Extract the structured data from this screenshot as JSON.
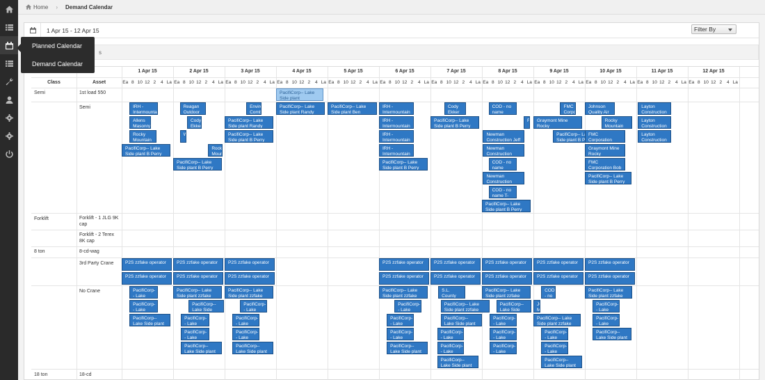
{
  "sidebar": {
    "icons": [
      "home-icon",
      "list-icon",
      "calendar-icon",
      "list-icon",
      "wrench-icon",
      "user-icon",
      "gear-icon",
      "gear-icon",
      "power-icon"
    ],
    "active_index": 2
  },
  "flyout": {
    "items": [
      "Planned Calendar",
      "Demand Calendar"
    ]
  },
  "breadcrumb": {
    "home": "Home",
    "current": "Demand Calendar"
  },
  "header": {
    "date_range": "1 Apr 15 - 12 Apr 15",
    "filter_label": "Filter By"
  },
  "tabs": {
    "partial_label": "s"
  },
  "grid": {
    "col_class": "Class",
    "col_asset": "Asset",
    "days": [
      "1 Apr 15",
      "2 Apr 15",
      "3 Apr 15",
      "4 Apr 15",
      "5 Apr 15",
      "6 Apr 15",
      "7 Apr 15",
      "8 Apr 15",
      "9 Apr 15",
      "10 Apr 15",
      "11 Apr 15",
      "12 Apr 15"
    ],
    "hours": [
      "Ea",
      "8",
      "10",
      "12",
      "2",
      "4",
      "La"
    ],
    "classes": [
      "Semi",
      "Forklift",
      "8 ton",
      "18 ton"
    ],
    "assets": [
      "1st load 550",
      "Semi",
      "Forklift - 1 JLG 9K cap",
      "Forklift - 2 Terex 8K cap",
      "8-cd-wag",
      "3rd Party Crane",
      "No Crane",
      "18-cd"
    ]
  },
  "events": [
    {
      "text": "PacifiCorp-- Lake Side plant",
      "day": 3,
      "start": 0.0,
      "width": 0.92,
      "row": 0,
      "sel": true
    },
    {
      "text": "PacifiCorp-- Lake Side plant Randy",
      "day": 3,
      "start": 0.0,
      "width": 0.94,
      "row": 1
    },
    {
      "text": "PacifiCorp-- Lake Side plant Ben",
      "day": 4,
      "start": 0.0,
      "width": 0.96,
      "row": 1
    },
    {
      "text": "IRH - Intermountain",
      "day": 0,
      "start": 0.15,
      "width": 0.55,
      "row": 1
    },
    {
      "text": "Allens Masonry",
      "day": 0,
      "start": 0.15,
      "width": 0.42,
      "row": 2
    },
    {
      "text": "Rocky Mountain",
      "day": 0,
      "start": 0.15,
      "width": 0.52,
      "row": 3
    },
    {
      "text": "PacifiCorp-- Lake Side plant B Perry",
      "day": 0,
      "start": 0.0,
      "width": 0.95,
      "row": 4
    },
    {
      "text": "Reagan Outdoor",
      "day": 1,
      "start": 0.13,
      "width": 0.5,
      "row": 1
    },
    {
      "text": "Cody Ekker",
      "day": 1,
      "start": 0.27,
      "width": 0.28,
      "row": 2
    },
    {
      "text": "W",
      "day": 1,
      "start": 0.13,
      "width": 0.08,
      "row": 3
    },
    {
      "text": "Rocky Moun",
      "day": 1,
      "start": 0.68,
      "width": 0.28,
      "row": 4
    },
    {
      "text": "PacifiCorp-- Lake Side plant B Perry",
      "day": 1,
      "start": 0.0,
      "width": 0.95,
      "row": 5
    },
    {
      "text": "Enviro Comb",
      "day": 2,
      "start": 0.42,
      "width": 0.3,
      "row": 1
    },
    {
      "text": "PacifiCorp-- Lake Side plant Randy",
      "day": 2,
      "start": 0.0,
      "width": 0.95,
      "row": 2
    },
    {
      "text": "PacifiCorp-- Lake Side plant B Perry",
      "day": 2,
      "start": 0.0,
      "width": 0.95,
      "row": 3
    },
    {
      "text": "IRH - Intermountain",
      "day": 5,
      "start": 0.0,
      "width": 0.68,
      "row": 1
    },
    {
      "text": "IRH - Intermountain",
      "day": 5,
      "start": 0.0,
      "width": 0.68,
      "row": 2
    },
    {
      "text": "IRH - Intermountain",
      "day": 5,
      "start": 0.0,
      "width": 0.68,
      "row": 3
    },
    {
      "text": "IRH - Intermountain",
      "day": 5,
      "start": 0.0,
      "width": 0.68,
      "row": 4
    },
    {
      "text": "PacifiCorp-- Lake Side plant B Perry",
      "day": 5,
      "start": 0.0,
      "width": 0.95,
      "row": 5
    },
    {
      "text": "Cody Ekker",
      "day": 6,
      "start": 0.27,
      "width": 0.42,
      "row": 1
    },
    {
      "text": "PacifiCorp-- Lake Side plant B Perry",
      "day": 6,
      "start": 0.0,
      "width": 0.95,
      "row": 2
    },
    {
      "text": "COD - no name",
      "day": 7,
      "start": 0.13,
      "width": 0.55,
      "row": 1
    },
    {
      "text": "F",
      "day": 7,
      "start": 0.81,
      "width": 0.08,
      "row": 2
    },
    {
      "text": "Newman Construction Jeff",
      "day": 7,
      "start": 0.02,
      "width": 0.8,
      "row": 3
    },
    {
      "text": "Newman Construction Josh",
      "day": 7,
      "start": 0.02,
      "width": 0.8,
      "row": 4
    },
    {
      "text": "COD - no name",
      "day": 7,
      "start": 0.13,
      "width": 0.55,
      "row": 5
    },
    {
      "text": "Newman Construction",
      "day": 7,
      "start": 0.02,
      "width": 0.8,
      "row": 6
    },
    {
      "text": "COD - no name T-",
      "day": 7,
      "start": 0.13,
      "width": 0.55,
      "row": 7
    },
    {
      "text": "PacifiCorp-- Lake Side plant B Perry",
      "day": 7,
      "start": 0.0,
      "width": 0.95,
      "row": 8
    },
    {
      "text": "FMC Corpo",
      "day": 8,
      "start": 0.52,
      "width": 0.3,
      "row": 1
    },
    {
      "text": "Graymont Mine Rocky",
      "day": 8,
      "start": 0.0,
      "width": 0.95,
      "row": 2
    },
    {
      "text": "PacifiCorp-- Lake Side plant B Perry",
      "day": 8,
      "start": 0.38,
      "width": 0.95,
      "row": 3
    },
    {
      "text": "Johnson Quality Air",
      "day": 9,
      "start": 0.0,
      "width": 0.58,
      "row": 1
    },
    {
      "text": "Rocky Mountain",
      "day": 9,
      "start": 0.32,
      "width": 0.6,
      "row": 2
    },
    {
      "text": "FMC Corporation Randy",
      "day": 9,
      "start": 0.0,
      "width": 0.78,
      "row": 3
    },
    {
      "text": "Graymont Mine Rocky",
      "day": 9,
      "start": 0.0,
      "width": 0.78,
      "row": 4
    },
    {
      "text": "FMC Corporation Bob S",
      "day": 9,
      "start": 0.0,
      "width": 0.78,
      "row": 5
    },
    {
      "text": "PacifiCorp-- Lake Side plant B Perry",
      "day": 9,
      "start": 0.0,
      "width": 0.9,
      "row": 6
    },
    {
      "text": "Layton Construction",
      "day": 10,
      "start": 0.03,
      "width": 0.65,
      "row": 1
    },
    {
      "text": "Layton Construction",
      "day": 10,
      "start": 0.03,
      "width": 0.65,
      "row": 2
    },
    {
      "text": "Layton Construction",
      "day": 10,
      "start": 0.03,
      "width": 0.65,
      "row": 3
    }
  ],
  "crane_events": [
    {
      "text": "P2S zzfake operator",
      "day": 0,
      "row": 0
    },
    {
      "text": "P2S zzfake operator",
      "day": 0,
      "row": 1
    },
    {
      "text": "P2S zzfake operator",
      "day": 1,
      "row": 0
    },
    {
      "text": "P2S zzfake operator",
      "day": 1,
      "row": 1
    },
    {
      "text": "P2S zzfake operator",
      "day": 2,
      "row": 0
    },
    {
      "text": "P2S zzfake operator",
      "day": 2,
      "row": 1
    },
    {
      "text": "P2S zzfake operator",
      "day": 5,
      "row": 0
    },
    {
      "text": "P2S zzfake operator",
      "day": 5,
      "row": 1
    },
    {
      "text": "P2S zzfake operator",
      "day": 6,
      "row": 0
    },
    {
      "text": "P2S zzfake operator",
      "day": 6,
      "row": 1
    },
    {
      "text": "P2S zzfake operator",
      "day": 7,
      "row": 0
    },
    {
      "text": "P2S zzfake operator",
      "day": 7,
      "row": 1
    },
    {
      "text": "P2S zzfake operator",
      "day": 8,
      "row": 0
    },
    {
      "text": "P2S zzfake operator",
      "day": 8,
      "row": 1
    },
    {
      "text": "P2S zzfake operator",
      "day": 9,
      "row": 0
    },
    {
      "text": "P2S zzfake operator",
      "day": 9,
      "row": 1
    }
  ],
  "nocrane_events": [
    {
      "text": "PacifiCorp-- Lake",
      "day": 0,
      "start": 0.15,
      "width": 0.55,
      "row": 0
    },
    {
      "text": "PacifiCorp-- Lake",
      "day": 0,
      "start": 0.15,
      "width": 0.55,
      "row": 1
    },
    {
      "text": "PacifiCorp-- Lake Side plant zzfake",
      "day": 0,
      "start": 0.15,
      "width": 0.8,
      "row": 2
    },
    {
      "text": "PacifiCorp-- Lake Side plant zzfake",
      "day": 1,
      "start": 0.0,
      "width": 0.95,
      "row": 0
    },
    {
      "text": "PacifiCorp-- Lake Side",
      "day": 1,
      "start": 0.3,
      "width": 0.68,
      "row": 1
    },
    {
      "text": "PacifiCorp-- Lake",
      "day": 1,
      "start": 0.15,
      "width": 0.55,
      "row": 2
    },
    {
      "text": "PacifiCorp-- Lake",
      "day": 1,
      "start": 0.15,
      "width": 0.55,
      "row": 3
    },
    {
      "text": "PacifiCorp-- Lake Side plant zzfake",
      "day": 1,
      "start": 0.15,
      "width": 0.8,
      "row": 4
    },
    {
      "text": "PacifiCorp-- Lake Side plant zzfake",
      "day": 2,
      "start": 0.0,
      "width": 0.95,
      "row": 0
    },
    {
      "text": "PacifiCorp-- Lake",
      "day": 2,
      "start": 0.3,
      "width": 0.52,
      "row": 1
    },
    {
      "text": "PacifiCorp-- Lake",
      "day": 2,
      "start": 0.15,
      "width": 0.52,
      "row": 2
    },
    {
      "text": "PacifiCorp-- Lake",
      "day": 2,
      "start": 0.15,
      "width": 0.52,
      "row": 3
    },
    {
      "text": "PacifiCorp-- Lake Side plant zzfake",
      "day": 2,
      "start": 0.15,
      "width": 0.8,
      "row": 4
    },
    {
      "text": "PacifiCorp-- Lake Side plant zzfake",
      "day": 5,
      "start": 0.0,
      "width": 0.95,
      "row": 0
    },
    {
      "text": "PacifiCorp-- Lake",
      "day": 5,
      "start": 0.3,
      "width": 0.52,
      "row": 1
    },
    {
      "text": "PacifiCorp-- Lake",
      "day": 5,
      "start": 0.15,
      "width": 0.52,
      "row": 2
    },
    {
      "text": "PacifiCorp-- Lake",
      "day": 5,
      "start": 0.15,
      "width": 0.52,
      "row": 3
    },
    {
      "text": "PacifiCorp-- Lake Side plant zzfake",
      "day": 5,
      "start": 0.15,
      "width": 0.8,
      "row": 4
    },
    {
      "text": "S.L. County",
      "day": 6,
      "start": 0.15,
      "width": 0.52,
      "row": 0
    },
    {
      "text": "PacifiCorp-- Lake Side plant zzfake",
      "day": 6,
      "start": 0.2,
      "width": 0.95,
      "row": 1
    },
    {
      "text": "PacifiCorp-- Lake Side plant",
      "day": 6,
      "start": 0.2,
      "width": 0.8,
      "row": 2
    },
    {
      "text": "PacifiCorp-- Lake",
      "day": 6,
      "start": 0.13,
      "width": 0.52,
      "row": 3
    },
    {
      "text": "PacifiCorp-- Lake",
      "day": 6,
      "start": 0.13,
      "width": 0.52,
      "row": 4
    },
    {
      "text": "PacifiCorp-- Lake Side plant zzfake",
      "day": 6,
      "start": 0.13,
      "width": 0.8,
      "row": 5
    },
    {
      "text": "PacifiCorp-- Lake Side plant zzfake",
      "day": 7,
      "start": 0.0,
      "width": 0.95,
      "row": 0
    },
    {
      "text": "PacifiCorp-- Lake Side plant zzfake",
      "day": 7,
      "start": 0.28,
      "width": 0.68,
      "row": 1
    },
    {
      "text": "PacifiCorp-- Lake",
      "day": 7,
      "start": 0.15,
      "width": 0.52,
      "row": 2
    },
    {
      "text": "PacifiCorp-- Lake",
      "day": 7,
      "start": 0.15,
      "width": 0.52,
      "row": 3
    },
    {
      "text": "PacifiCorp-- Lake",
      "day": 7,
      "start": 0.15,
      "width": 0.52,
      "row": 4
    },
    {
      "text": "COD - no",
      "day": 8,
      "start": 0.15,
      "width": 0.28,
      "row": 0
    },
    {
      "text": "JC M",
      "day": 8,
      "start": 0.0,
      "width": 0.13,
      "row": 1
    },
    {
      "text": "PacifiCorp-- Lake Side plant zzfake",
      "day": 8,
      "start": 0.0,
      "width": 0.92,
      "row": 2
    },
    {
      "text": "PacifiCorp-- Lake",
      "day": 8,
      "start": 0.15,
      "width": 0.52,
      "row": 3
    },
    {
      "text": "PacifiCorp-- Lake",
      "day": 8,
      "start": 0.15,
      "width": 0.52,
      "row": 4
    },
    {
      "text": "PacifiCorp-- Lake Side plant zzfake",
      "day": 8,
      "start": 0.15,
      "width": 0.8,
      "row": 5
    },
    {
      "text": "PacifiCorp-- Lake Side plant zzfake",
      "day": 9,
      "start": 0.0,
      "width": 0.92,
      "row": 0
    },
    {
      "text": "PacifiCorp-- Lake",
      "day": 9,
      "start": 0.15,
      "width": 0.52,
      "row": 1
    },
    {
      "text": "PacifiCorp-- Lake",
      "day": 9,
      "start": 0.15,
      "width": 0.52,
      "row": 2
    },
    {
      "text": "PacifiCorp-- Lake Side plant zzfake",
      "day": 9,
      "start": 0.15,
      "width": 0.76,
      "row": 3
    }
  ]
}
